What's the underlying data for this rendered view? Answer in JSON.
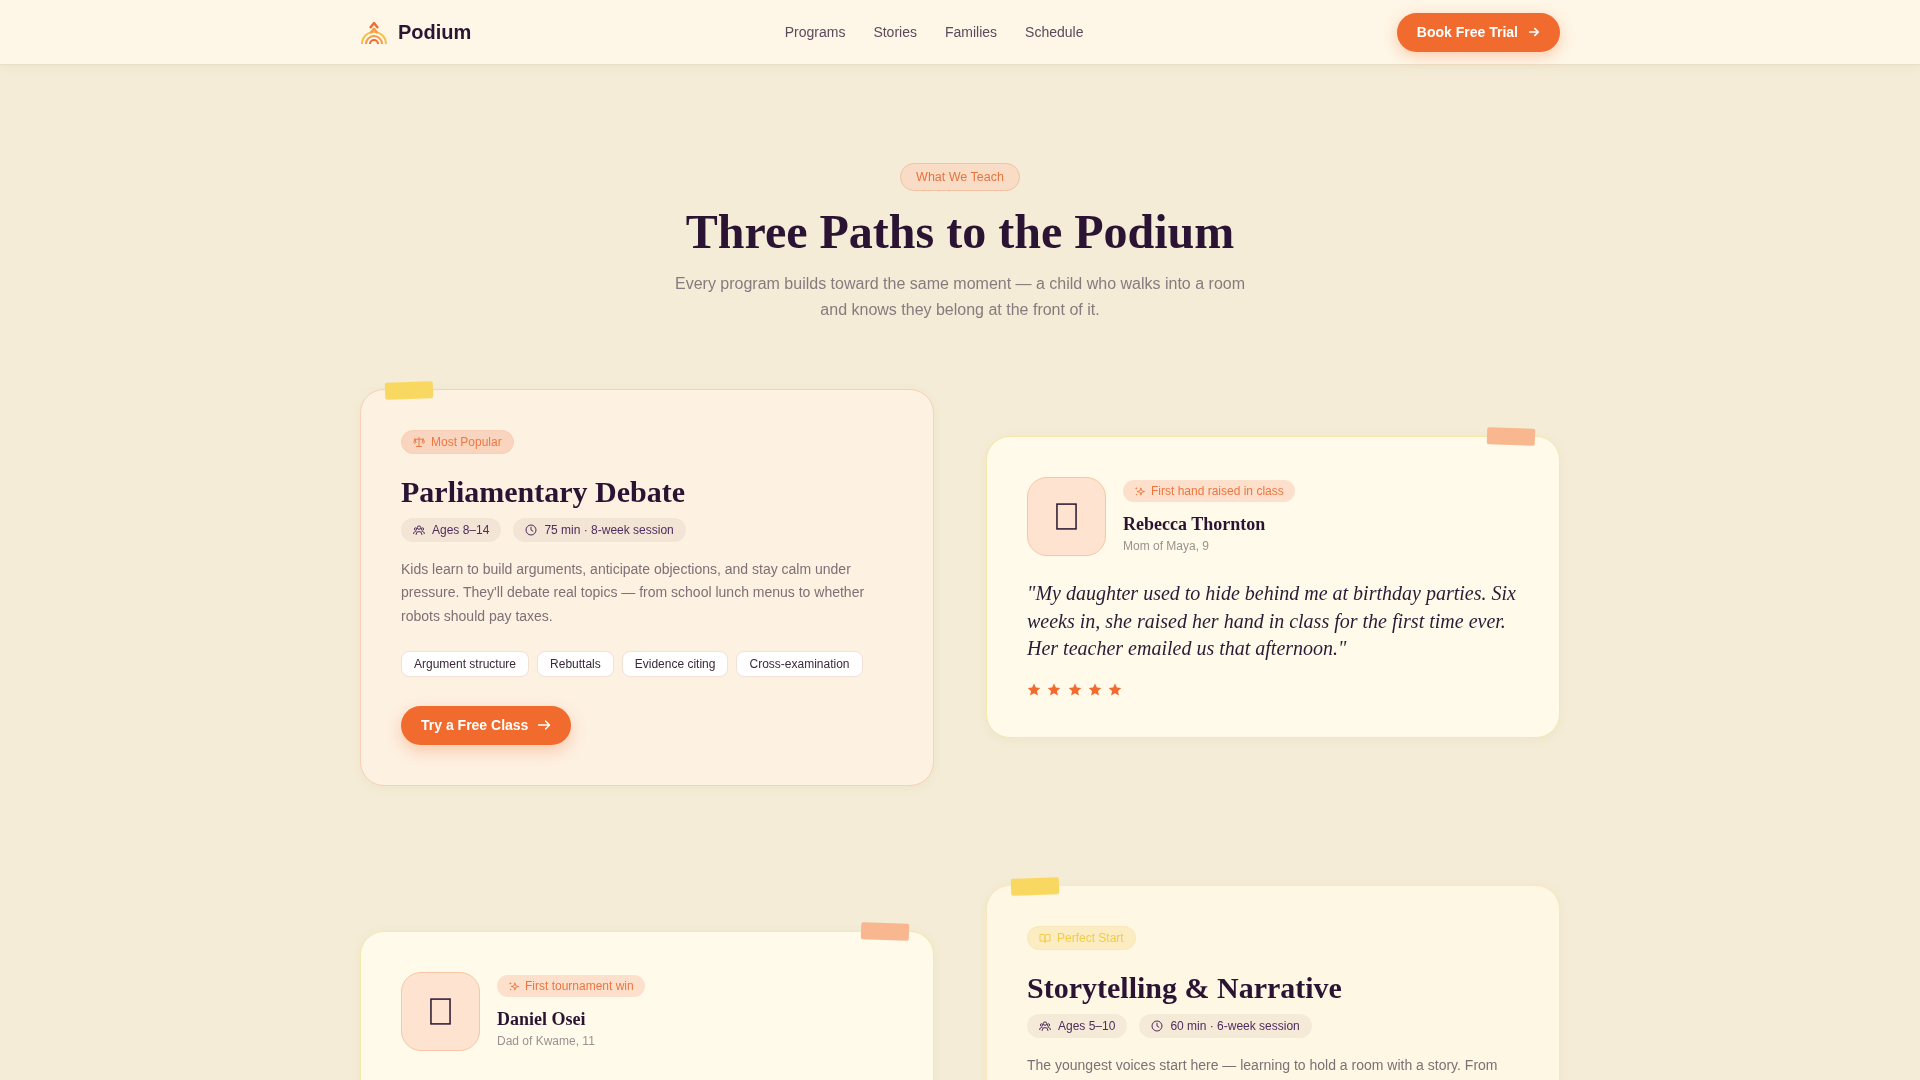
{
  "header": {
    "logo": "Podium",
    "nav": [
      "Programs",
      "Stories",
      "Families",
      "Schedule"
    ],
    "cta": "Book Free Trial"
  },
  "hero": {
    "eyebrow": "What We Teach",
    "title": "Three Paths to the Podium",
    "subtitle": "Every program builds toward the same moment — a child who walks into a room and knows they belong at the front of it."
  },
  "rows": [
    {
      "cards": [
        {
          "kind": "program",
          "color": "#ec7a45",
          "badge": "Most Popular",
          "title": "Parliamentary Debate",
          "meta": [
            {
              "kind": "ages",
              "text": "Ages 8–14"
            },
            {
              "kind": "duration",
              "text": "75 min · 8-week session"
            }
          ],
          "description": "Kids learn to build arguments, anticipate objections, and stay calm under pressure. They'll debate real topics — from school lunch menus to whether robots should pay taxes.",
          "skills": [
            "Argument structure",
            "Rebuttals",
            "Evidence citing",
            "Cross-examination"
          ],
          "button": "Try a Free Class"
        },
        {
          "kind": "testimonial",
          "badge": "First hand raised in class",
          "name": "Rebecca Thornton",
          "relation": "Mom of Maya, 9",
          "quote": "\"My daughter used to hide behind me at birthday parties. Six weeks in, she raised her hand in class for the first time ever. Her teacher emailed us that afternoon.\"",
          "stars": 5
        }
      ]
    },
    {
      "cards": [
        {
          "kind": "testimonial",
          "badge": "First tournament win",
          "name": "Daniel Osei",
          "relation": "Dad of Kwame, 11"
        },
        {
          "kind": "program",
          "color": "#f2cb4c",
          "badge": "Perfect Start",
          "title": "Storytelling & Narrative",
          "meta": [
            {
              "kind": "ages",
              "text": "Ages 5–10"
            },
            {
              "kind": "duration",
              "text": "60 min · 6-week session"
            }
          ],
          "description": "The youngest voices start here — learning to hold a room with a story. From"
        }
      ]
    }
  ]
}
